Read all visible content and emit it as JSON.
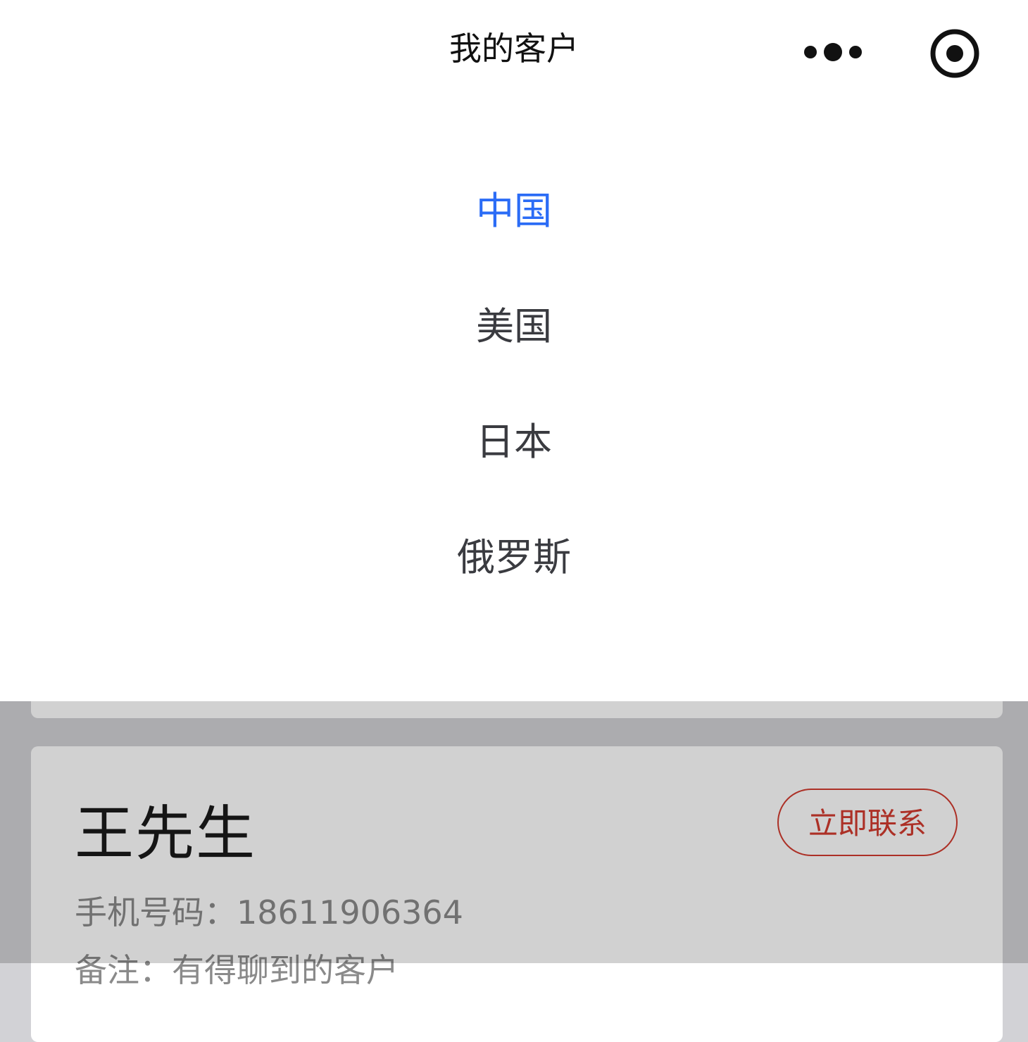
{
  "navbar": {
    "title": "我的客户",
    "more_icon": "more-dots-icon",
    "close_icon": "target-circle-icon"
  },
  "filter": {
    "selected": "中国",
    "options": [
      "中国",
      "美国",
      "日本",
      "俄罗斯"
    ]
  },
  "colors": {
    "accent": "#2b6cf6",
    "danger": "#d23b2f",
    "option_text": "#3a3b40",
    "secondary_text": "#8a8a8a"
  },
  "customer": {
    "name": "王先生",
    "contact_label": "立即联系",
    "phone_label": "手机号码：",
    "phone": "18611906364",
    "remark": "备注：有得聊到的客户"
  }
}
